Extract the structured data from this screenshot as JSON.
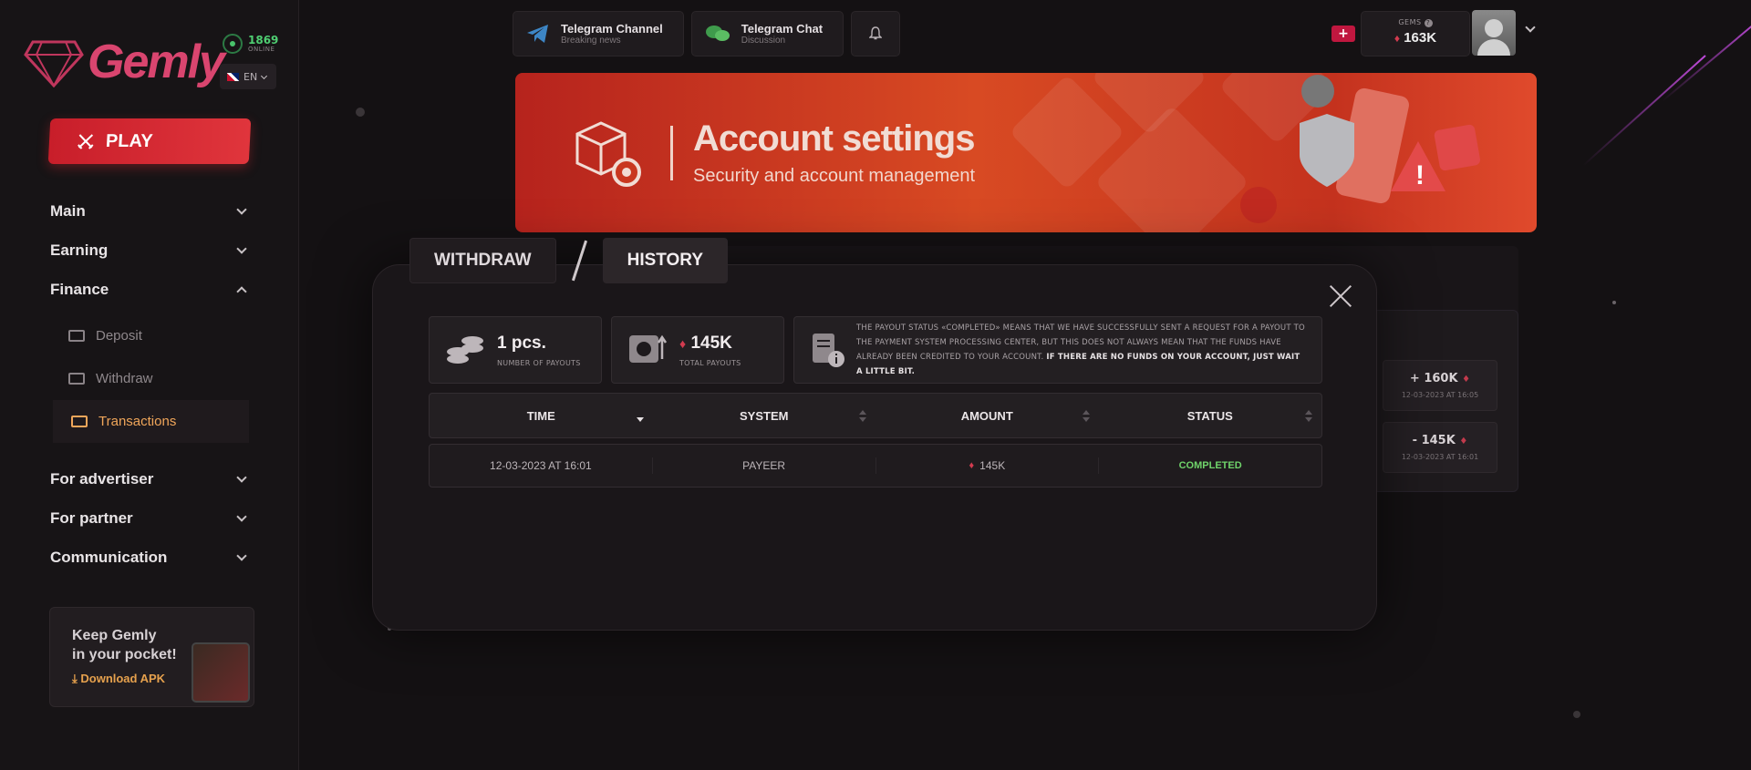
{
  "brand": {
    "name": "Gemly",
    "online_count": "1869",
    "online_label": "ONLINE",
    "language": "EN"
  },
  "sidebar": {
    "play_label": "PLAY",
    "items": [
      {
        "label": "Main",
        "expanded": false
      },
      {
        "label": "Earning",
        "expanded": false
      },
      {
        "label": "Finance",
        "expanded": true,
        "children": [
          {
            "label": "Deposit",
            "active": false
          },
          {
            "label": "Withdraw",
            "active": false
          },
          {
            "label": "Transactions",
            "active": true
          }
        ]
      },
      {
        "label": "For advertiser",
        "expanded": false
      },
      {
        "label": "For partner",
        "expanded": false
      },
      {
        "label": "Communication",
        "expanded": false
      }
    ],
    "promo": {
      "line1": "Keep Gemly",
      "line2": "in your pocket!",
      "link": "Download APK"
    }
  },
  "topbar": {
    "telegram_channel": {
      "title": "Telegram Channel",
      "subtitle": "Breaking news"
    },
    "telegram_chat": {
      "title": "Telegram Chat",
      "subtitle": "Discussion"
    },
    "gems": {
      "label": "GEMS",
      "value": "163K",
      "plus": "+",
      "minus": "−"
    }
  },
  "banner": {
    "title": "Account settings",
    "subtitle": "Security and account management"
  },
  "background_history": [
    {
      "amount": "+ 160K",
      "time": "12-03-2023 AT 16:05"
    },
    {
      "amount": "- 145K",
      "time": "12-03-2023 AT 16:01"
    }
  ],
  "modal": {
    "tabs": [
      {
        "label": "WITHDRAW",
        "active": false
      },
      {
        "label": "HISTORY",
        "active": true
      }
    ],
    "stats": {
      "payouts_count": "1 pcs.",
      "payouts_count_label": "NUMBER OF PAYOUTS",
      "payouts_total": "145K",
      "payouts_total_label": "TOTAL PAYOUTS"
    },
    "note": {
      "text": "THE PAYOUT STATUS «COMPLETED» MEANS THAT WE HAVE SUCCESSFULLY SENT A REQUEST FOR A PAYOUT TO THE PAYMENT SYSTEM PROCESSING CENTER, BUT THIS DOES NOT ALWAYS MEAN THAT THE FUNDS HAVE ALREADY BEEN CREDITED TO YOUR ACCOUNT.",
      "bold": "IF THERE ARE NO FUNDS ON YOUR ACCOUNT, JUST WAIT A LITTLE BIT."
    },
    "table": {
      "columns": [
        "TIME",
        "SYSTEM",
        "AMOUNT",
        "STATUS"
      ],
      "rows": [
        {
          "time": "12-03-2023 AT 16:01",
          "system": "PAYEER",
          "amount": "145K",
          "status": "COMPLETED"
        }
      ]
    }
  },
  "colors": {
    "accent": "#d9456f",
    "play": "#d62b33",
    "active_link": "#f0a65a",
    "status_completed": "#6fd36a",
    "banner": "#d84a23"
  }
}
